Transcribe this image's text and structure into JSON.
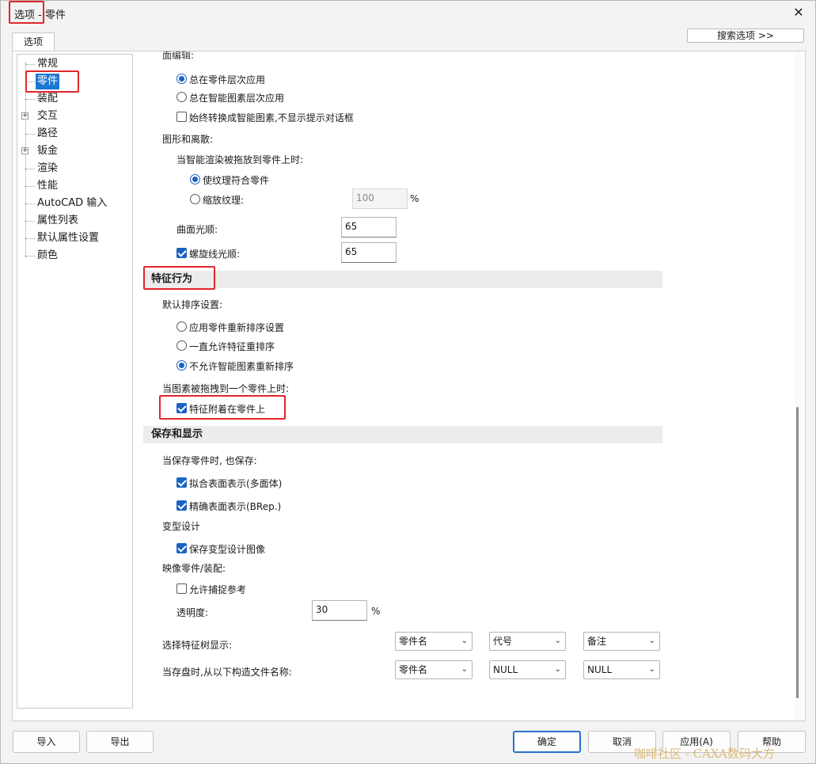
{
  "window": {
    "title": "选项 - 零件",
    "close_glyph": "✕"
  },
  "tab": {
    "label": "选项"
  },
  "search_button": {
    "label": "搜索选项 >>"
  },
  "tree": {
    "items": [
      {
        "label": "常规",
        "expandable": false,
        "selected": false
      },
      {
        "label": "零件",
        "expandable": false,
        "selected": true
      },
      {
        "label": "装配",
        "expandable": false,
        "selected": false
      },
      {
        "label": "交互",
        "expandable": true,
        "selected": false
      },
      {
        "label": "路径",
        "expandable": false,
        "selected": false
      },
      {
        "label": "钣金",
        "expandable": true,
        "selected": false
      },
      {
        "label": "渲染",
        "expandable": false,
        "selected": false
      },
      {
        "label": "性能",
        "expandable": false,
        "selected": false
      },
      {
        "label": "AutoCAD 输入",
        "expandable": false,
        "selected": false
      },
      {
        "label": "属性列表",
        "expandable": false,
        "selected": false
      },
      {
        "label": "默认属性设置",
        "expandable": false,
        "selected": false
      },
      {
        "label": "颜色",
        "expandable": false,
        "selected": false
      }
    ]
  },
  "content": {
    "partial_header": "面编辑:",
    "apply_level": {
      "options": [
        {
          "label": "总在零件层次应用",
          "checked": true
        },
        {
          "label": "总在智能图素层次应用",
          "checked": false
        }
      ],
      "always_convert": {
        "label": "始终转换成智能图素,不显示提示对话框",
        "checked": false
      }
    },
    "graphics": {
      "heading": "图形和离散:",
      "render_drop_label": "当智能渲染被拖放到零件上时:",
      "fit_texture": {
        "label": "使纹理符合零件",
        "checked": true
      },
      "scale_texture": {
        "label": "缩放纹理:",
        "checked": false
      },
      "scale_value": "100",
      "scale_unit": "%",
      "surface_smooth_label": "曲面光顺:",
      "surface_smooth_value": "65",
      "helix_smooth": {
        "label": "螺旋线光顺:",
        "checked": true
      },
      "helix_smooth_value": "65"
    },
    "feature_behavior": {
      "section_title": "特征行为",
      "sort_label": "默认排序设置:",
      "sort_options": [
        {
          "label": "应用零件重新排序设置",
          "checked": false
        },
        {
          "label": "一直允许特征重排序",
          "checked": false
        },
        {
          "label": "不允许智能图素重新排序",
          "checked": true
        }
      ],
      "drag_label": "当图素被拖拽到一个零件上时:",
      "attach_feature": {
        "label": "特征附着在零件上",
        "checked": true
      }
    },
    "save_display": {
      "section_title": "保存和显示",
      "also_save_label": "当保存零件时, 也保存:",
      "fit_surface": {
        "label": "拟合表面表示(多面体)",
        "checked": true
      },
      "exact_surface": {
        "label": "精确表面表示(BRep.)",
        "checked": true
      },
      "variant_heading": "变型设计",
      "save_variant": {
        "label": "保存变型设计图像",
        "checked": true
      },
      "mirror_heading": "映像零件/装配:",
      "allow_snap": {
        "label": "允许捕捉参考",
        "checked": false
      },
      "transparency_label": "透明度:",
      "transparency_value": "30",
      "transparency_unit": "%",
      "tree_display_label": "选择特征树显示:",
      "tree_display_selects": [
        "零件名",
        "代号",
        "备注"
      ],
      "filename_label": "当存盘时,从以下构造文件名称:",
      "filename_selects": [
        "零件名",
        "NULL",
        "NULL"
      ]
    }
  },
  "buttons": {
    "import": "导入",
    "export": "导出",
    "ok": "确定",
    "cancel": "取消",
    "apply": "应用(A)",
    "help": "帮助"
  },
  "watermark": "咖啡社区 - CAXA数码大方",
  "colors": {
    "accent": "#1a63c4",
    "selection": "#1a78d4",
    "highlight_box": "#e0262c"
  }
}
